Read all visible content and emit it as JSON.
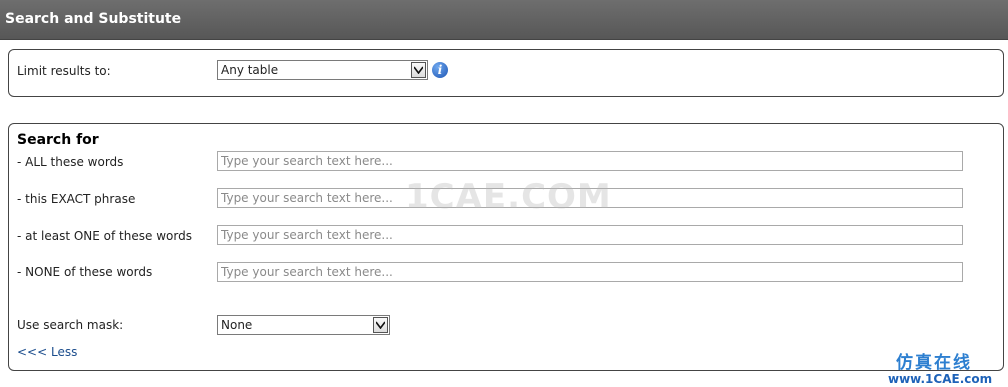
{
  "header": {
    "title": "Search and Substitute"
  },
  "limit": {
    "label": "Limit results to:",
    "selected": "Any table",
    "info_icon": "info-icon"
  },
  "search": {
    "heading": "Search for",
    "fields": [
      {
        "label": "- ALL these words",
        "placeholder": "Type your search text here...",
        "value": ""
      },
      {
        "label": "- this EXACT phrase",
        "placeholder": "Type your search text here...",
        "value": ""
      },
      {
        "label": "- at least ONE of these words",
        "placeholder": "Type your search text here...",
        "value": ""
      },
      {
        "label": "- NONE of these words",
        "placeholder": "Type your search text here...",
        "value": ""
      }
    ],
    "mask_label": "Use search mask:",
    "mask_selected": "None",
    "less_link": "<<< Less"
  },
  "watermark": {
    "center": "1CAE.COM",
    "brand_cn": "仿真在线",
    "brand_url": "www.1CAE.com"
  }
}
